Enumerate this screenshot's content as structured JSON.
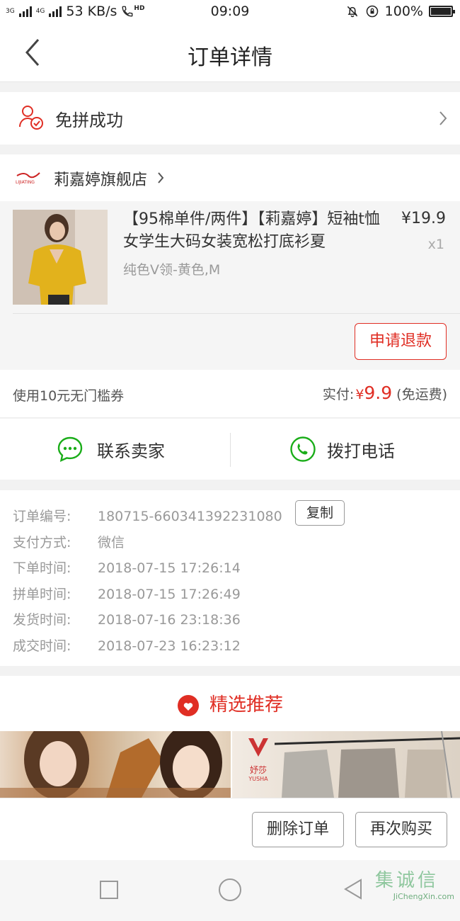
{
  "status_bar": {
    "network_left": "3G",
    "network_right": "4G",
    "speed": "53 KB/s",
    "call_label": "HD",
    "time": "09:09",
    "battery": "100%"
  },
  "header": {
    "title": "订单详情"
  },
  "group_status": {
    "label": "免拼成功"
  },
  "shop": {
    "name": "莉嘉婷旗舰店",
    "logo_text": "LIJIATING"
  },
  "product": {
    "title": "【95棉单件/两件】【莉嘉婷】短袖t恤女学生大码女装宽松打底衫夏",
    "spec": "纯色V领-黄色,M",
    "price": "¥19.9",
    "qty": "x1",
    "refund_label": "申请退款"
  },
  "summary": {
    "coupon": "使用10元无门槛券",
    "paid_label": "实付:",
    "currency": "¥",
    "amount": "9.9",
    "shipping_note": "(免运费)"
  },
  "contact": {
    "seller_label": "联系卖家",
    "call_label": "拨打电话"
  },
  "order_info": {
    "rows": [
      {
        "key": "订单编号:",
        "value": "180715-660341392231080"
      },
      {
        "key": "支付方式:",
        "value": "微信"
      },
      {
        "key": "下单时间:",
        "value": "2018-07-15 17:26:14"
      },
      {
        "key": "拼单时间:",
        "value": "2018-07-15 17:26:49"
      },
      {
        "key": "发货时间:",
        "value": "2018-07-16 23:18:36"
      },
      {
        "key": "成交时间:",
        "value": "2018-07-23 16:23:12"
      }
    ],
    "copy_label": "复制"
  },
  "recommend": {
    "title": "精选推荐",
    "brand_cn": "妤莎",
    "brand_en": "YUSHA"
  },
  "actions": {
    "delete_label": "删除订单",
    "rebuy_label": "再次购买"
  },
  "watermark": {
    "cn": "集诚信",
    "en": "JiChengXin.com"
  },
  "colors": {
    "accent": "#e02e24",
    "wechat_green": "#1aad19"
  }
}
